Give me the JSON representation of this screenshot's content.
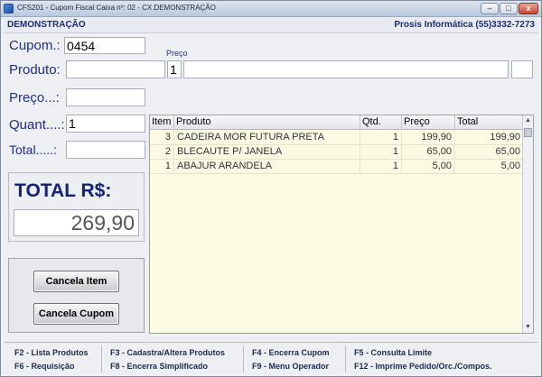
{
  "window": {
    "title": "CFS201 - Cupom Fiscal   Caixa nº: 02   - CX.DEMONSTRAÇÃO",
    "min_label": "–",
    "max_label": "□",
    "close_label": "x"
  },
  "header": {
    "left": "DEMONSTRAÇÃO",
    "right": "Prosis Informática (55)3332-7273"
  },
  "form": {
    "cupom_label": "Cupom.:",
    "cupom_value": "0454",
    "produto_label": "Produto:",
    "preco_small_label": "Preço",
    "produto_qty_value": "1",
    "preco_label": "Preço...:",
    "quant_label": "Quant....:",
    "quant_value": "1",
    "total_label": "Total.....:"
  },
  "total": {
    "title": "TOTAL R$:",
    "value": "269,90"
  },
  "buttons": {
    "cancela_item": "Cancela Item",
    "cancela_cupom": "Cancela Cupom"
  },
  "grid": {
    "columns": [
      "Item",
      "Produto",
      "Qtd.",
      "Preço",
      "Total"
    ],
    "rows": [
      {
        "item": "3",
        "produto": "CADEIRA MOR FUTURA PRETA",
        "qtd": "1",
        "preco": "199,90",
        "total": "199,90"
      },
      {
        "item": "2",
        "produto": "BLECAUTE P/ JANELA",
        "qtd": "1",
        "preco": "65,00",
        "total": "65,00"
      },
      {
        "item": "1",
        "produto": "ABAJUR ARANDELA",
        "qtd": "1",
        "preco": "5,00",
        "total": "5,00"
      }
    ]
  },
  "fkeys": {
    "f2": "F2 - Lista Produtos",
    "f3": "F3 - Cadastra/Altera Produtos",
    "f4": "F4 - Encerra Cupom",
    "f5": "F5  - Consulta Limite",
    "f6": "F6 - Requisição",
    "f8": "F8 - Encerra Simplificado",
    "f9": "F9 - Menu Operador",
    "f12": "F12 - Imprime Pedido/Orc./Compos."
  }
}
